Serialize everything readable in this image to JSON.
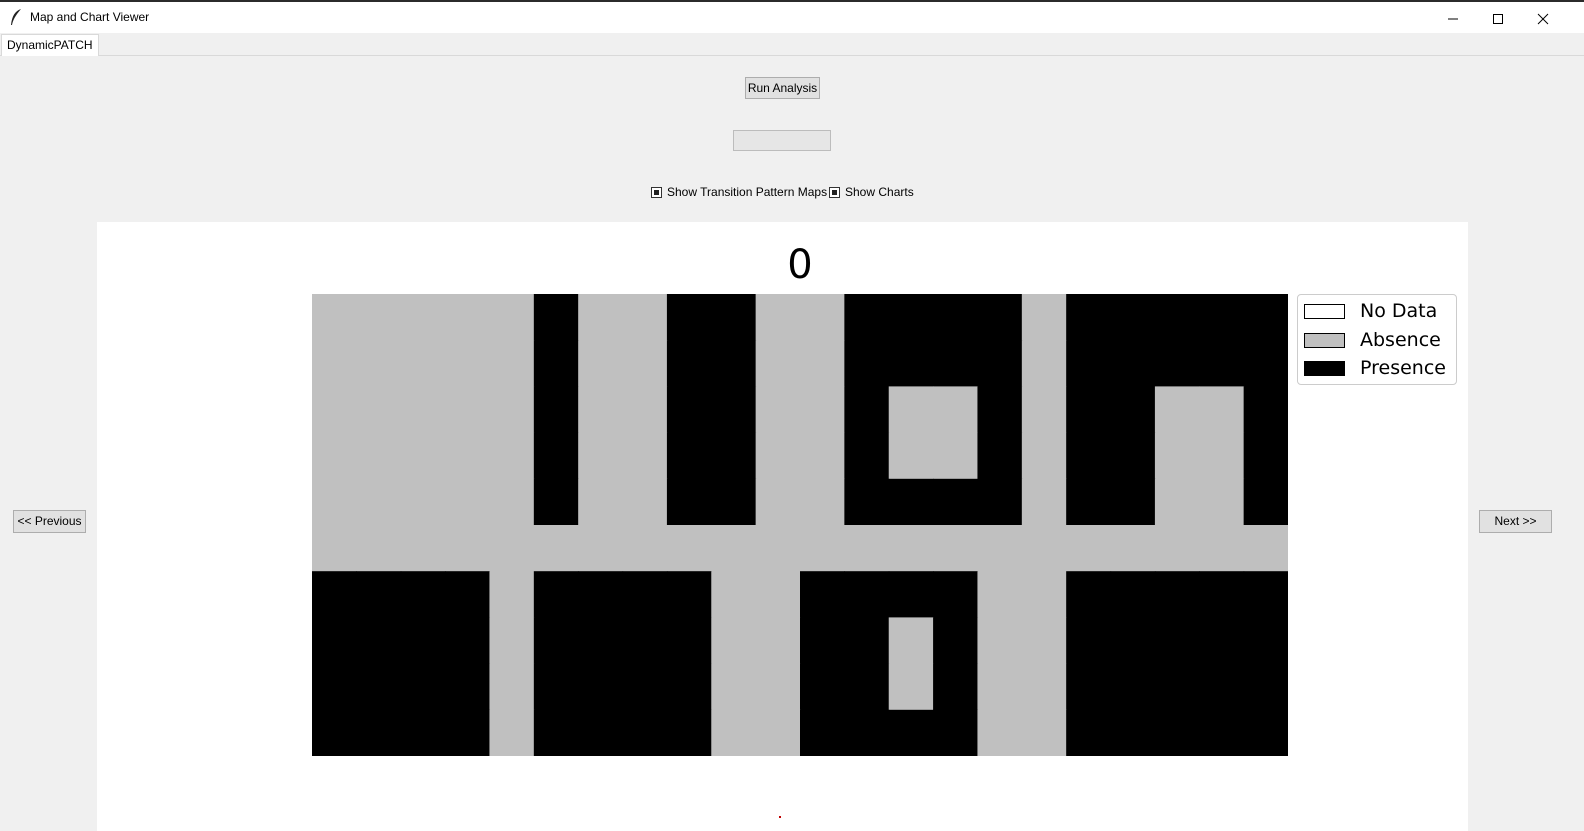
{
  "window": {
    "title": "Map and Chart Viewer"
  },
  "tabs": [
    {
      "label": "DynamicPATCH"
    }
  ],
  "controls": {
    "run_label": "Run Analysis",
    "progress": 0,
    "show_maps_label": "Show Transition Pattern Maps",
    "show_maps_checked": true,
    "show_charts_label": "Show Charts",
    "show_charts_checked": true,
    "prev_label": "<< Previous",
    "next_label": "Next >>"
  },
  "map": {
    "title": "0",
    "rows": [
      "0000010011001111011111",
      "0000010011001111011111",
      "0000010011001001011001",
      "0000010011001001011001",
      "0000010011001111011001",
      "0000000000000000000000",
      "1111011110011110011111",
      "1111011110011010011111",
      "1111011110011010011111",
      "1111011110011110011111"
    ],
    "colors": {
      "no_data": "#ffffff",
      "absence": "#c0c0c0",
      "presence": "#000000"
    },
    "legend": [
      {
        "label": "No Data",
        "color": "#ffffff"
      },
      {
        "label": "Absence",
        "color": "#c0c0c0"
      },
      {
        "label": "Presence",
        "color": "#000000"
      }
    ]
  }
}
